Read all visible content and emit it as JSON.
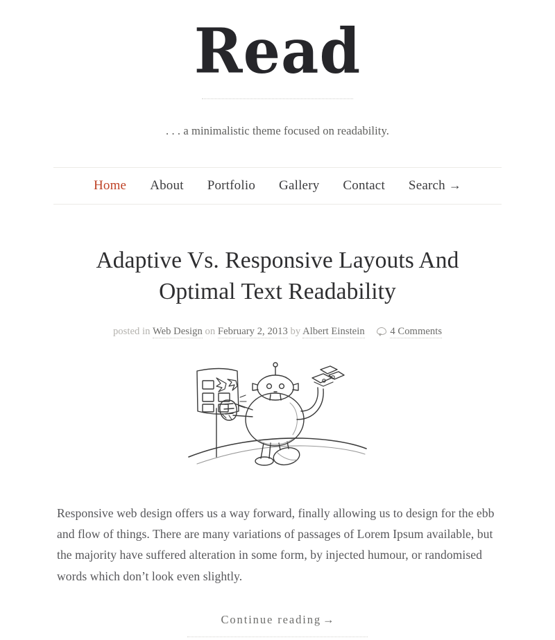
{
  "site": {
    "logo": "Read",
    "tagline": ". . . a minimalistic theme focused on readability."
  },
  "nav": {
    "items": [
      {
        "label": "Home",
        "active": true
      },
      {
        "label": "About",
        "active": false
      },
      {
        "label": "Portfolio",
        "active": false
      },
      {
        "label": "Gallery",
        "active": false
      },
      {
        "label": "Contact",
        "active": false
      },
      {
        "label": "Search",
        "active": false,
        "arrow": "→"
      }
    ],
    "active_color": "#bf4226",
    "default_color": "#3b3b3d"
  },
  "post": {
    "title": "Adaptive Vs. Responsive Layouts And Optimal Text Readability",
    "meta": {
      "posted_in_label": "posted in",
      "category": "Web Design",
      "on_label": "on",
      "date": "February 2, 2013",
      "by_label": "by",
      "author": "Albert Einstein",
      "comments": "4 Comments",
      "comments_icon": "speech-bubble-icon"
    },
    "figure": {
      "alt": "pencil sketch of a robot punching a layout board while holding devices",
      "name": "robot-sketch-illustration"
    },
    "body": "Responsive web design offers us a way forward, finally allowing us to design for the ebb and flow of things. There are many variations of passages of Lorem Ipsum available,  but the majority have suffered alteration in some form, by injected humour, or randomised words which don’t look even slightly.",
    "continue_label": "Continue reading",
    "continue_arrow": "→"
  },
  "theme": {
    "background": "#ffffff",
    "text": "#57575a",
    "heading": "#2e2e30",
    "muted": "#b4b2ae",
    "rule": "#eceae6"
  }
}
